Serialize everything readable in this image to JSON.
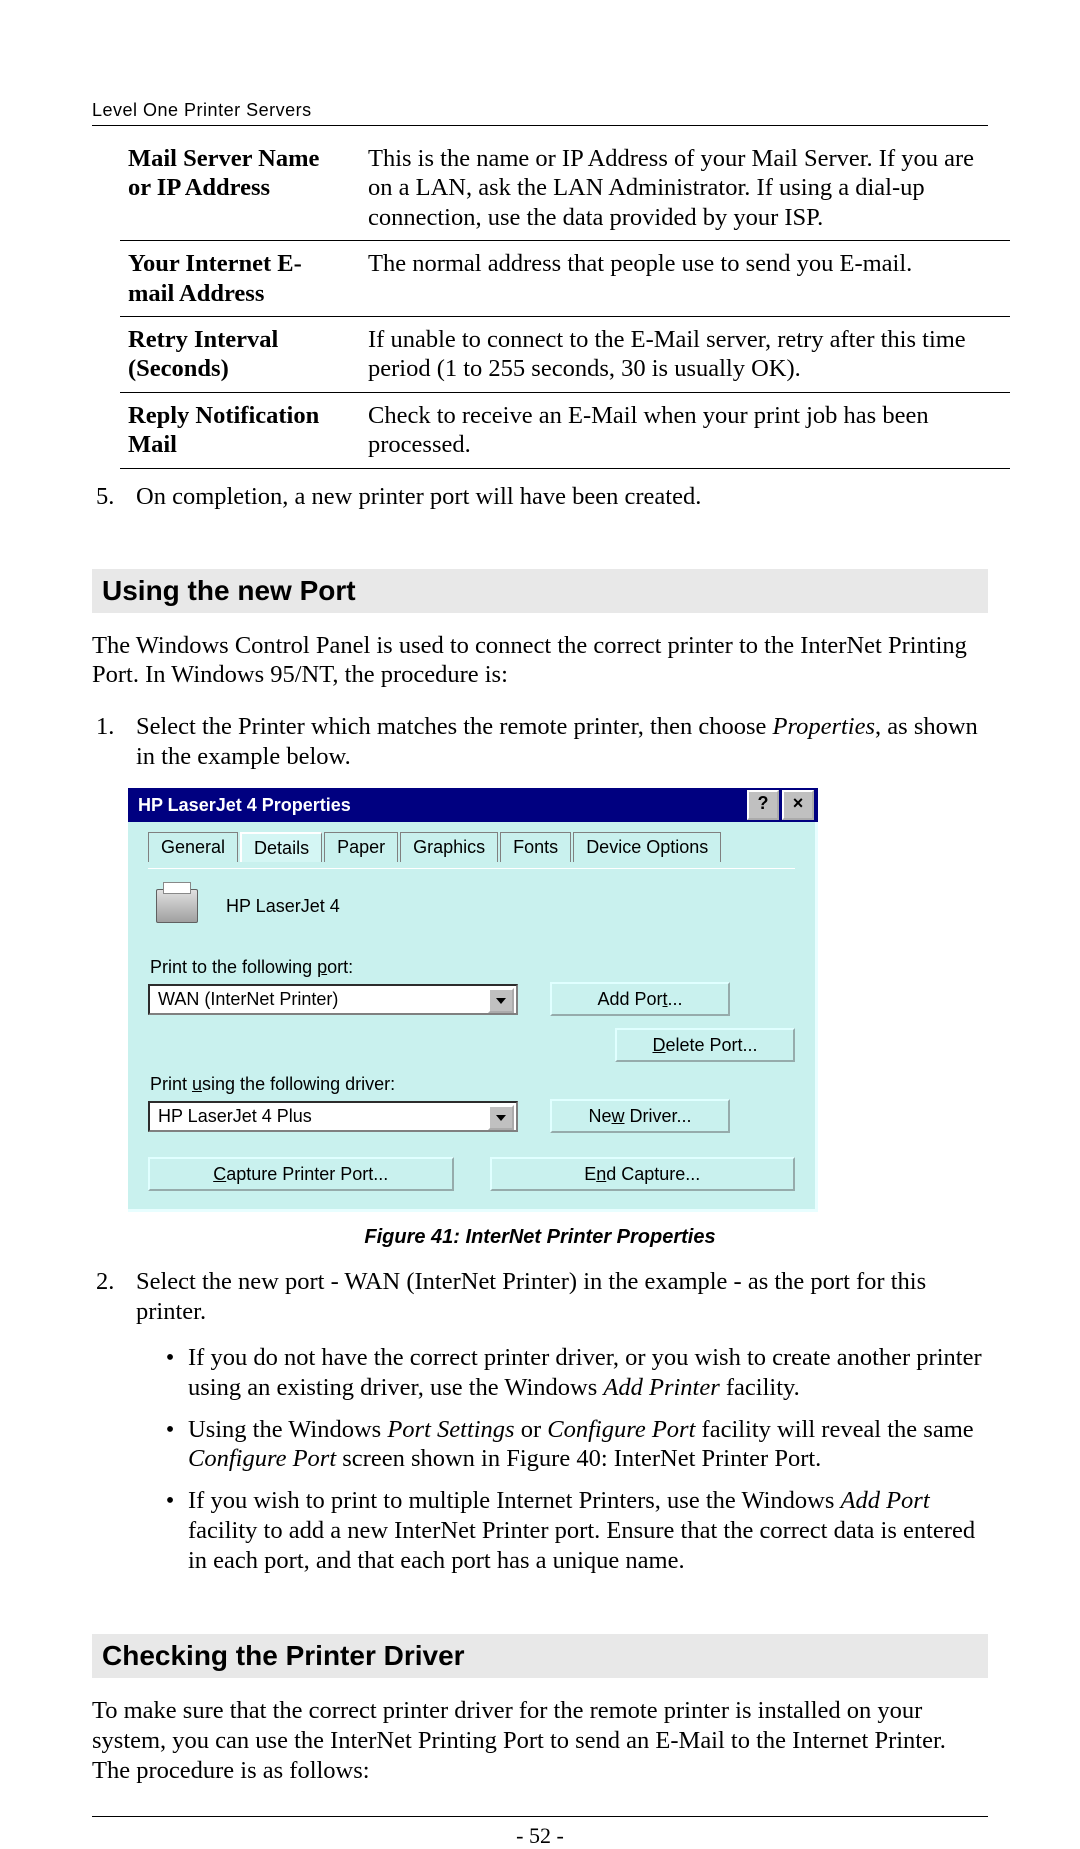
{
  "header": {
    "running": "Level One Printer Servers"
  },
  "table": {
    "rows": [
      {
        "label": "Mail Server Name or IP Address",
        "desc": "This is the name or IP Address of your Mail Server. If you are on a LAN, ask the LAN Administrator. If using a dial-up connection, use the data provided by your ISP."
      },
      {
        "label": "Your Internet E-mail Address",
        "desc": "The normal address that people use to send you E-mail."
      },
      {
        "label": "Retry Interval (Seconds)",
        "desc": "If unable to connect to the E-Mail server, retry after this time period (1 to 255 seconds, 30 is usually OK)."
      },
      {
        "label": "Reply Notification Mail",
        "desc": "Check to receive an E-Mail when your print job has been processed."
      }
    ]
  },
  "step5": {
    "num": "5.",
    "text": "On completion, a new printer port will have been created."
  },
  "section1": {
    "heading": "Using the new Port",
    "intro": "The Windows Control Panel is used to connect the correct printer to the InterNet Printing Port. In Windows 95/NT, the procedure is:",
    "ol1_num": "1.",
    "ol1_a": "Select the Printer which matches the remote printer, then choose ",
    "ol1_i": "Properties",
    "ol1_b": ", as shown in the example below."
  },
  "dialog": {
    "title": "HP LaserJet 4 Properties",
    "tabs": [
      "General",
      "Details",
      "Paper",
      "Graphics",
      "Fonts",
      "Device Options"
    ],
    "active_tab_index": 1,
    "printer_name": "HP LaserJet 4",
    "port_label": "Print to the following port:",
    "port_value": "WAN  (InterNet Printer)",
    "driver_label": "Print using the following driver:",
    "driver_value": "HP LaserJet 4 Plus",
    "buttons": {
      "add_port": "Add Port...",
      "delete_port": "Delete Port...",
      "new_driver": "New Driver...",
      "capture": "Capture Printer Port...",
      "end_capture": "End Capture..."
    }
  },
  "figure_caption": "Figure 41: InterNet Printer Properties",
  "after_fig": {
    "ol2_num": "2.",
    "ol2_text": "Select the new port - WAN (InterNet Printer) in the example - as the port for this printer.",
    "b1_a": "If you do not have the correct printer driver, or you wish to create another printer using an existing driver, use the Windows ",
    "b1_i": "Add Printer",
    "b1_b": " facility.",
    "b2_a": "Using the Windows ",
    "b2_i1": "Port Settings",
    "b2_mid": " or ",
    "b2_i2": "Configure Port",
    "b2_b": " facility will reveal the same ",
    "b2_i3": "Configure Port",
    "b2_c": " screen shown in Figure 40: InterNet Printer Port.",
    "b3_a": "If you wish to print to multiple Internet Printers, use the Windows ",
    "b3_i": "Add Port",
    "b3_b": " facility to add a new InterNet Printer port. Ensure that the correct data is entered in each port, and that each port has a unique name."
  },
  "section2": {
    "heading": "Checking the Printer Driver",
    "para": "To make sure that the correct printer driver for the remote printer is installed on your system, you can use the InterNet Printing Port to send an E-Mail to the Internet Printer. The procedure is as follows:"
  },
  "footer": {
    "page": "- 52 -"
  }
}
